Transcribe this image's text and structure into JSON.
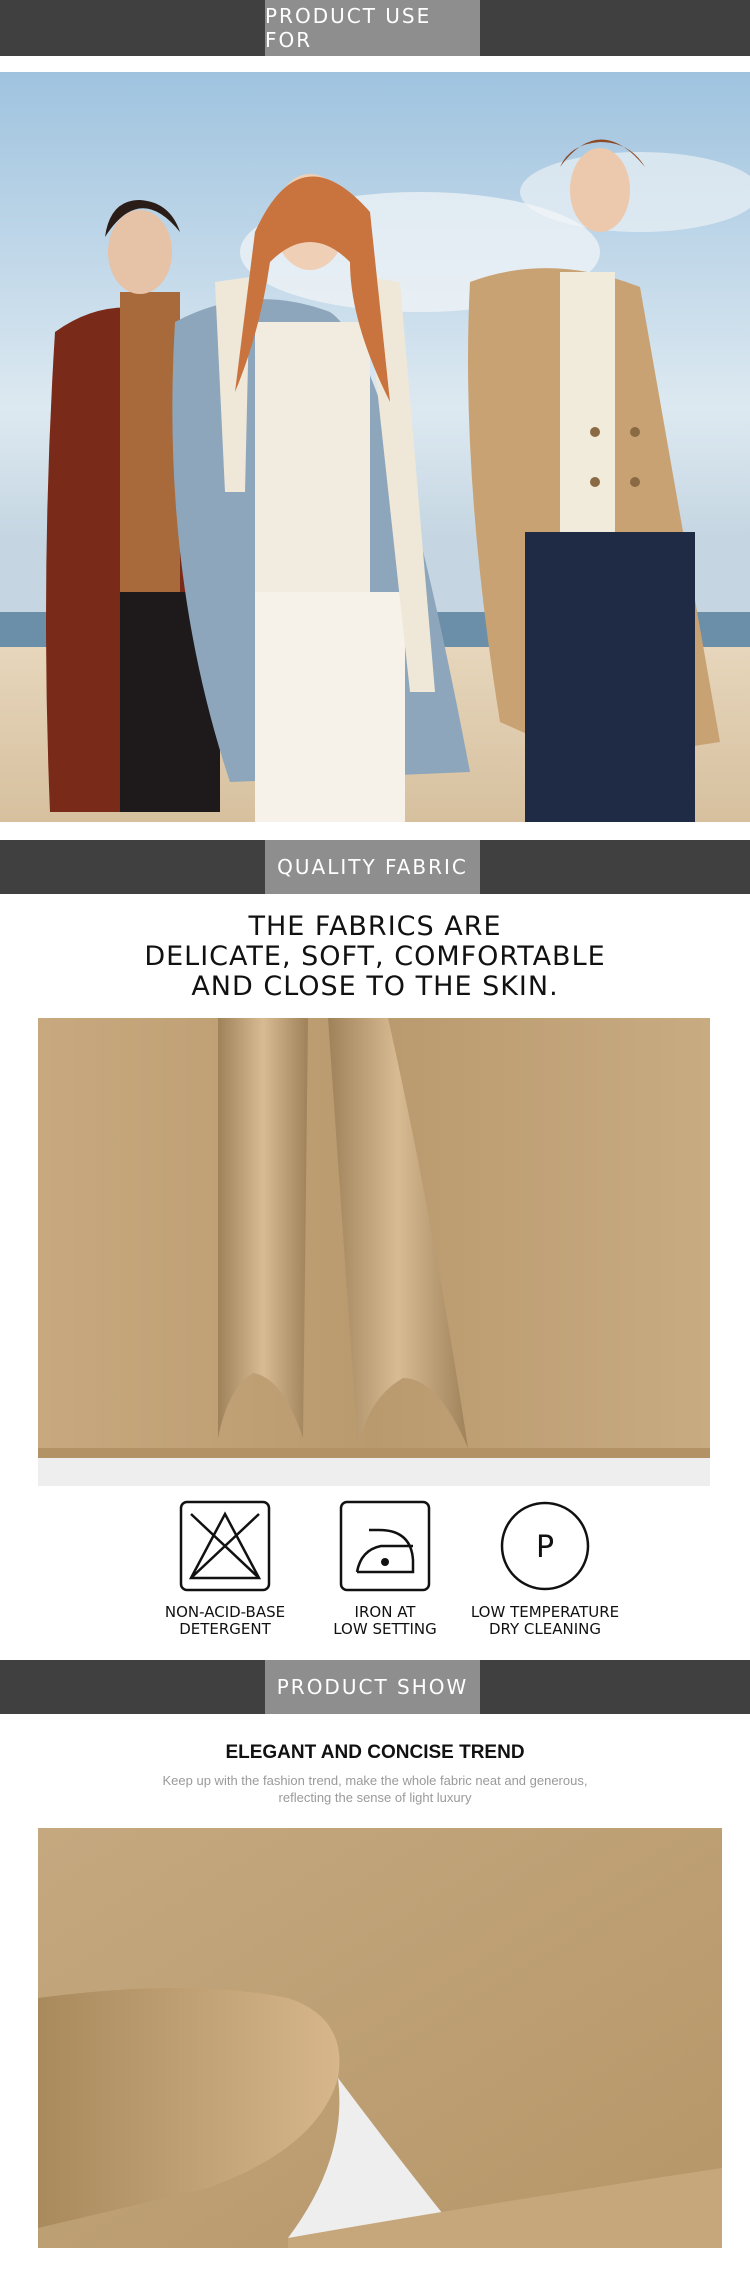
{
  "sections": {
    "use_for": {
      "label": "PRODUCT USE FOR"
    },
    "quality": {
      "label": "QUALITY FABRIC"
    },
    "show": {
      "label": "PRODUCT SHOW"
    }
  },
  "quality_headline": {
    "line1": "THE FABRICS ARE",
    "line2": "DELICATE, SOFT, COMFORTABLE",
    "line3": "AND CLOSE TO THE SKIN."
  },
  "care": [
    {
      "icon": "no-bleach-icon",
      "line1": "NON-ACID-BASE",
      "line2": "DETERGENT"
    },
    {
      "icon": "iron-low-icon",
      "line1": "IRON AT",
      "line2": "LOW SETTING"
    },
    {
      "icon": "dry-clean-p-icon",
      "symbol": "P",
      "line1": "LOW TEMPERATURE",
      "line2": "DRY CLEANING"
    }
  ],
  "show": {
    "title": "ELEGANT AND CONCISE TREND",
    "desc1": "Keep up with the fashion trend, make the whole fabric neat and generous,",
    "desc2": "reflecting the sense of light luxury"
  },
  "colors": {
    "band": "#404040",
    "tab": "#8e8e8e",
    "fabric": "#c2a37a"
  }
}
